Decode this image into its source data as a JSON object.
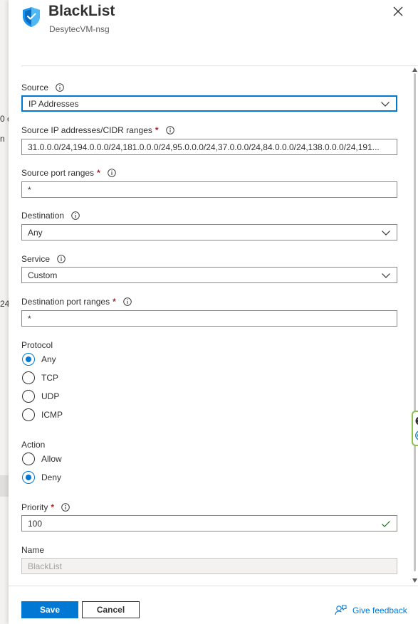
{
  "background": {
    "fragments": [
      "0 c",
      "n",
      "24"
    ]
  },
  "header": {
    "title": "BlackList",
    "subtitle": "DesytecVM-nsg"
  },
  "form": {
    "source": {
      "label": "Source",
      "value": "IP Addresses"
    },
    "source_ips": {
      "label": "Source IP addresses/CIDR ranges",
      "required": "*",
      "value": "31.0.0.0/24,194.0.0.0/24,181.0.0.0/24,95.0.0.0/24,37.0.0.0/24,84.0.0.0/24,138.0.0.0/24,191..."
    },
    "source_ports": {
      "label": "Source port ranges",
      "required": "*",
      "value": "*"
    },
    "destination": {
      "label": "Destination",
      "value": "Any"
    },
    "service": {
      "label": "Service",
      "value": "Custom"
    },
    "dest_ports": {
      "label": "Destination port ranges",
      "required": "*",
      "value": "*"
    },
    "protocol": {
      "label": "Protocol",
      "options": [
        "Any",
        "TCP",
        "UDP",
        "ICMP"
      ],
      "selected": "Any"
    },
    "action": {
      "label": "Action",
      "options": [
        "Allow",
        "Deny"
      ],
      "selected": "Deny"
    },
    "priority": {
      "label": "Priority",
      "required": "*",
      "value": "100"
    },
    "name": {
      "label": "Name",
      "value": "BlackList"
    }
  },
  "footer": {
    "save_label": "Save",
    "cancel_label": "Cancel",
    "feedback_label": "Give feedback"
  },
  "colors": {
    "accent": "#0078d4",
    "required": "#a4262c",
    "valid": "#107c10",
    "extension": "#8bc34a"
  },
  "icons": [
    "shield-icon",
    "close-icon",
    "info-icon",
    "chevron-down-icon",
    "checkmark-icon",
    "feedback-icon",
    "extension-close-icon",
    "extension-logo-icon"
  ]
}
